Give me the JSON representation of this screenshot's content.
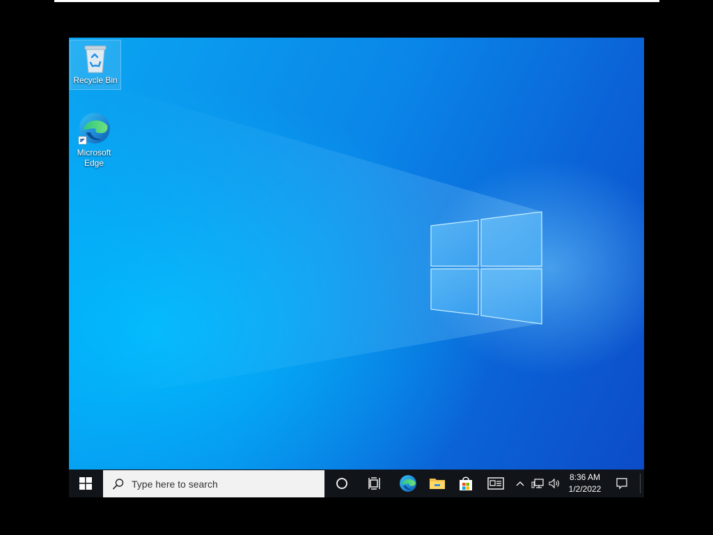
{
  "desktop": {
    "icons": [
      {
        "label": "Recycle Bin",
        "icon": "recycle-bin-icon"
      },
      {
        "label": "Microsoft Edge",
        "icon": "edge-icon"
      }
    ],
    "wallpaper": "Windows 10 hero wallpaper",
    "accent": "#0a86e8"
  },
  "taskbar": {
    "start_icon": "windows-start-icon",
    "search_placeholder": "Type here to search",
    "pinned": [
      {
        "name": "Cortana",
        "icon": "cortana-circle-icon"
      },
      {
        "name": "Task View",
        "icon": "task-view-icon"
      },
      {
        "name": "Microsoft Edge",
        "icon": "edge-icon"
      },
      {
        "name": "File Explorer",
        "icon": "folder-icon"
      },
      {
        "name": "Microsoft Store",
        "icon": "store-bag-icon"
      },
      {
        "name": "News and interests",
        "icon": "news-icon"
      }
    ],
    "tray_icons": [
      "chevron-up-icon",
      "network-icon",
      "volume-icon"
    ],
    "time": "8:36 AM",
    "date": "1/2/2022",
    "notifications_icon": "action-center-icon"
  }
}
